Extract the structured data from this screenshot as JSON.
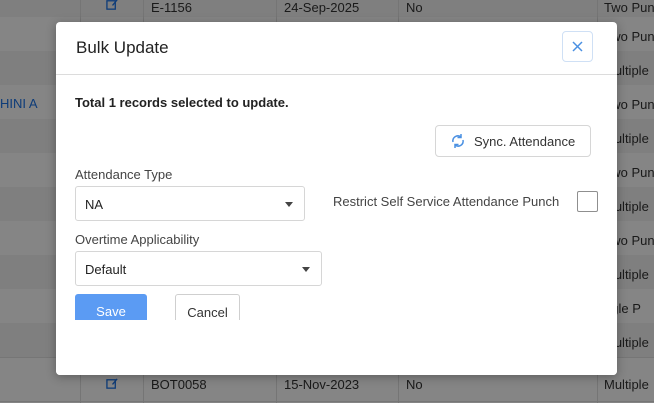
{
  "background": {
    "side_label": "HINI A",
    "rows": [
      {
        "code": "E-1156",
        "date": "24-Sep-2025",
        "flag": "No",
        "type": "Two Pun"
      },
      {
        "code": "",
        "date": "",
        "flag": "",
        "type": "Two Pun"
      },
      {
        "code": "",
        "date": "",
        "flag": "",
        "type": "Multiple"
      },
      {
        "code": "",
        "date": "",
        "flag": "",
        "type": "Two Pun"
      },
      {
        "code": "",
        "date": "",
        "flag": "",
        "type": "Multiple"
      },
      {
        "code": "",
        "date": "",
        "flag": "",
        "type": "Two Pun"
      },
      {
        "code": "",
        "date": "",
        "flag": "",
        "type": "Multiple"
      },
      {
        "code": "",
        "date": "",
        "flag": "",
        "type": "Two Pun"
      },
      {
        "code": "",
        "date": "",
        "flag": "",
        "type": "Multiple"
      },
      {
        "code": "",
        "date": "",
        "flag": "",
        "type": "ngle P"
      },
      {
        "code": "",
        "date": "",
        "flag": "",
        "type": "Multiple"
      },
      {
        "code": "BOT0058",
        "date": "15-Nov-2023",
        "flag": "No",
        "type": "Multiple"
      }
    ]
  },
  "modal": {
    "title": "Bulk Update",
    "summary": "Total 1 records selected to update.",
    "sync_label": "Sync. Attendance",
    "attendance_type": {
      "label": "Attendance Type",
      "value": "NA"
    },
    "overtime": {
      "label": "Overtime Applicability",
      "value": "Default"
    },
    "restrict_label": "Restrict Self Service Attendance Punch",
    "restrict_checked": false,
    "save_label": "Save",
    "cancel_label": "Cancel"
  },
  "colors": {
    "accent": "#5b9bf3",
    "link": "#1a73e8",
    "close_icon": "#4a90e2"
  },
  "icons": {
    "close": "close-icon",
    "sync": "sync-icon",
    "edit": "edit-icon"
  }
}
